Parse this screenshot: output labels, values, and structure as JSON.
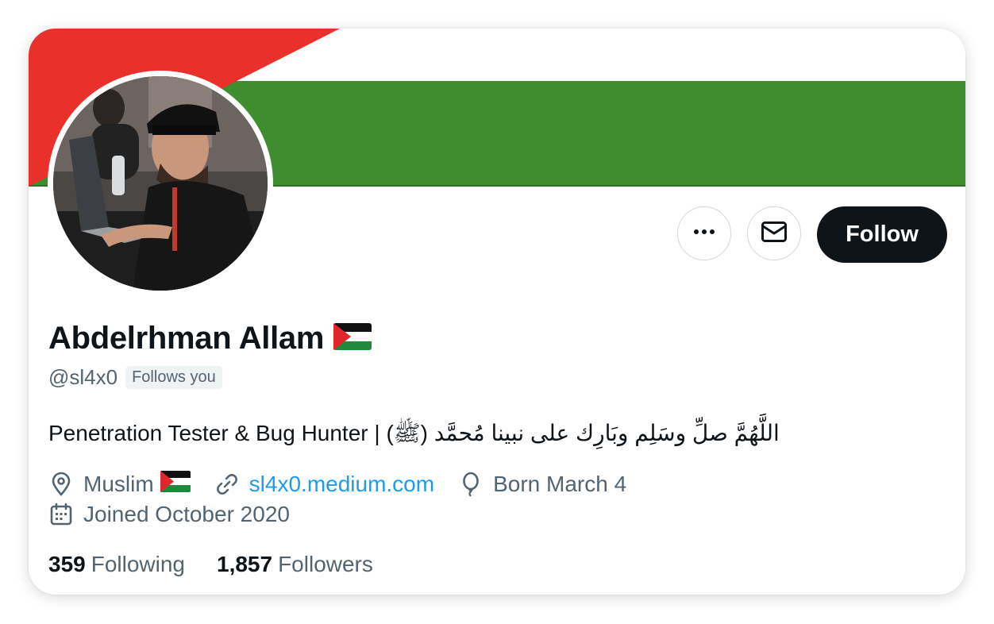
{
  "profile": {
    "display_name": "Abdelrhman Allam",
    "handle": "@sl4x0",
    "follows_you": "Follows you",
    "bio": "Penetration Tester & Bug Hunter | (ﷺ) اللَّهُمَّ صلِّ وسَلِم وبَارِك على نبينا مُحمَّد"
  },
  "actions": {
    "follow_label": "Follow",
    "more_icon": "more-horizontal-icon",
    "message_icon": "envelope-icon"
  },
  "meta": {
    "location": "Muslim",
    "website": "sl4x0.medium.com",
    "birthday": "Born March 4",
    "joined": "Joined October 2020"
  },
  "stats": {
    "following_count": "359",
    "following_label": "Following",
    "followers_count": "1,857",
    "followers_label": "Followers"
  },
  "colors": {
    "follow_button": "#0f1419",
    "link": "#1d9bf0",
    "muted_text": "#536471",
    "banner_red": "#e9302a",
    "banner_green": "#3e8e2f",
    "banner_white": "#ffffff"
  }
}
